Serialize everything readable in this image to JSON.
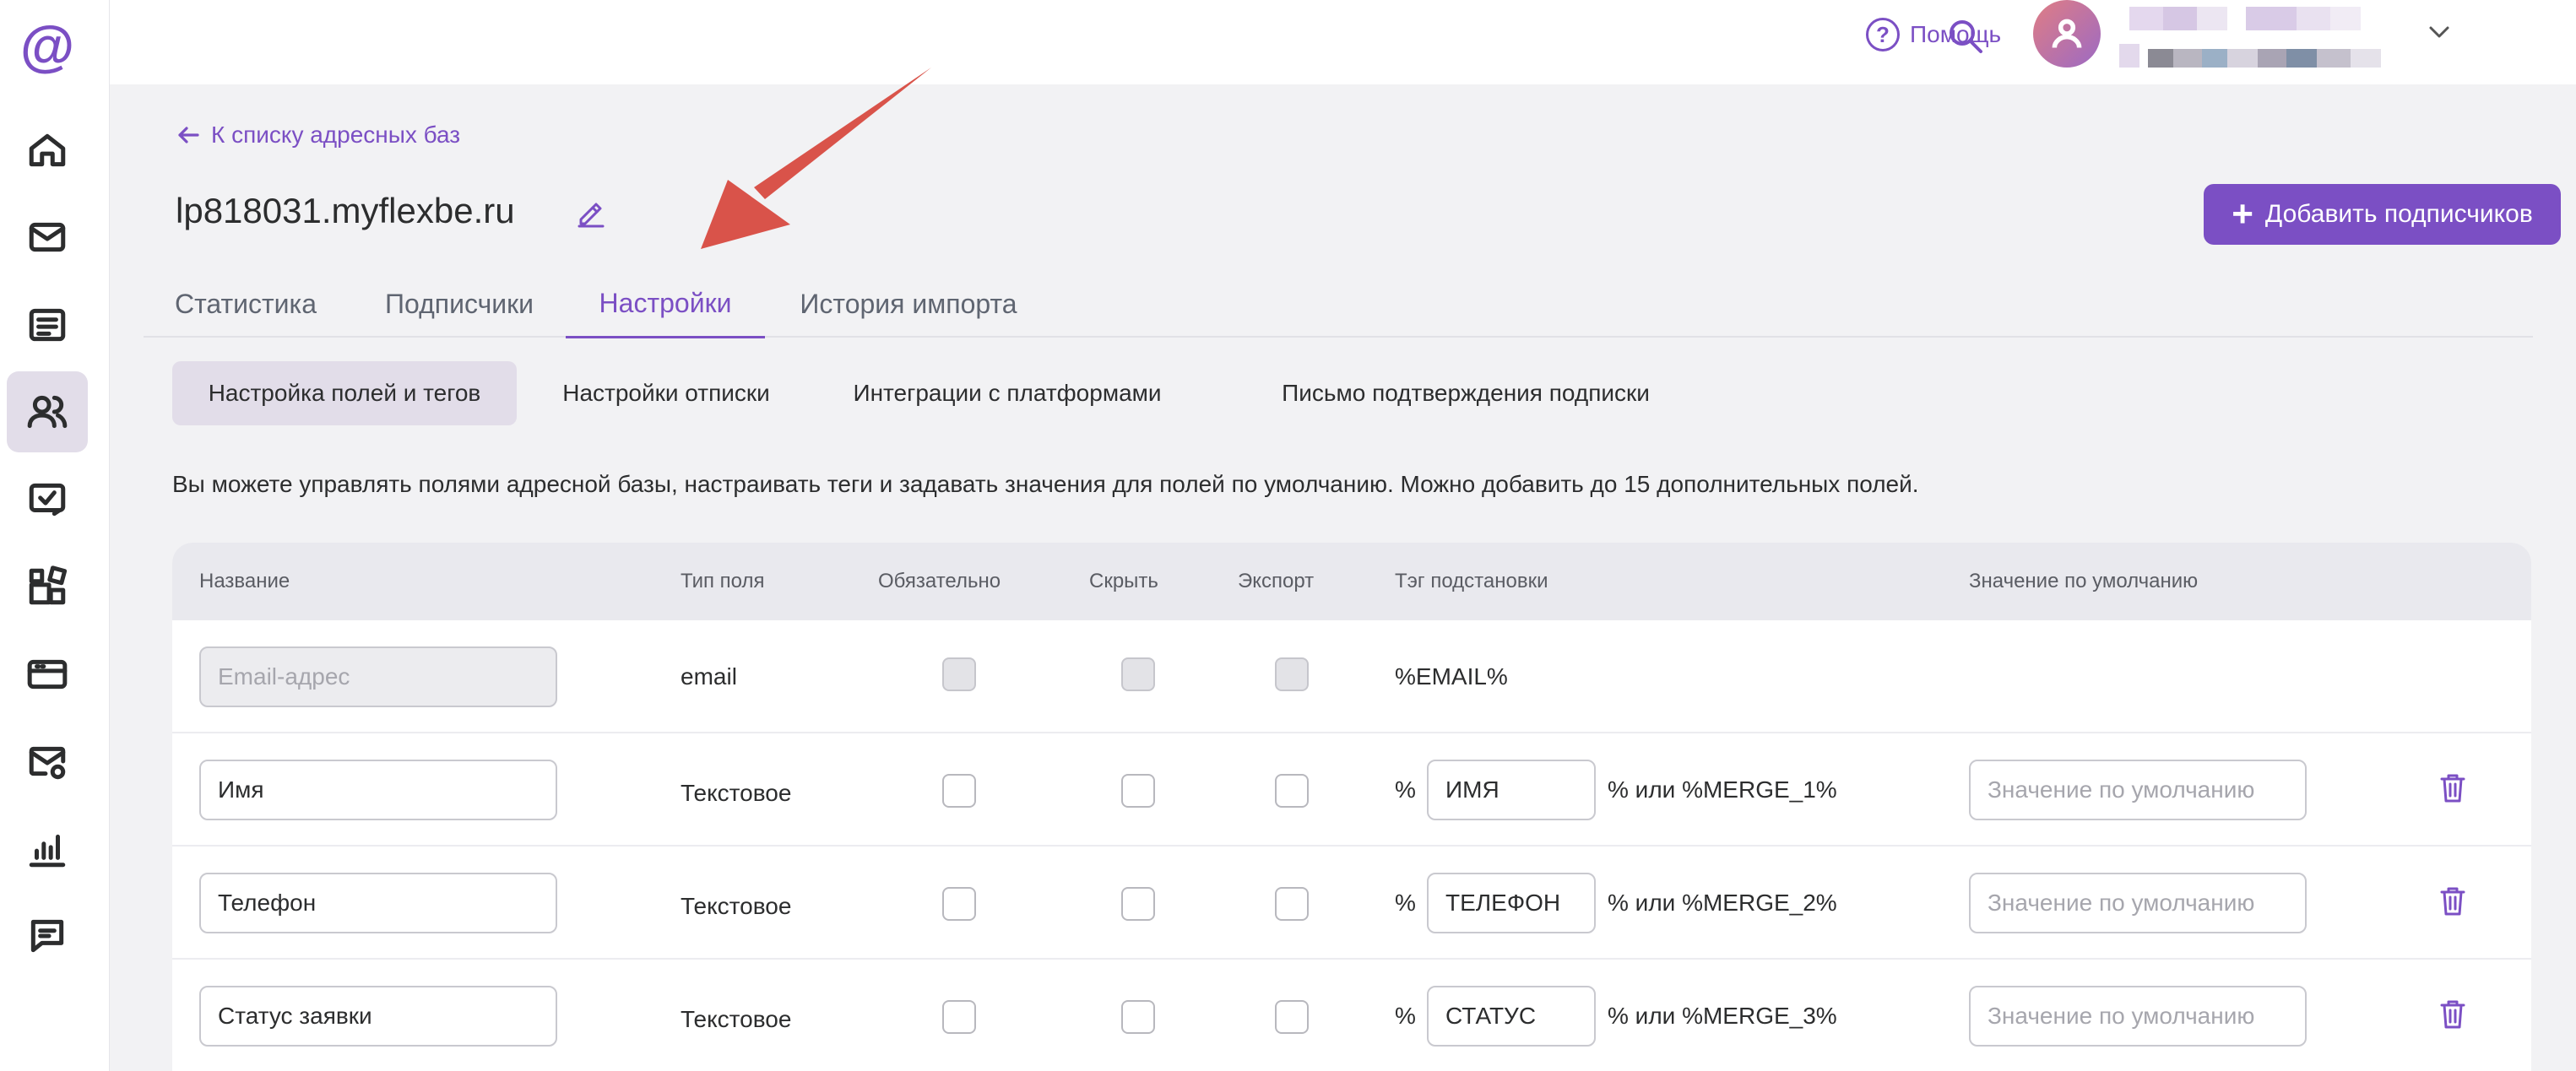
{
  "app": {
    "logo": "@"
  },
  "topbar": {
    "help_label": "Помощь",
    "help_glyph": "?"
  },
  "back_link": {
    "label": "К списку адресных баз"
  },
  "page": {
    "title": "lp818031.myflexbe.ru",
    "add_button": "Добавить подписчиков",
    "add_glyph": "+"
  },
  "tabs": [
    {
      "label": "Статистика"
    },
    {
      "label": "Подписчики"
    },
    {
      "label": "Настройки"
    },
    {
      "label": "История импорта"
    }
  ],
  "subtabs": [
    {
      "label": "Настройка полей и тегов"
    },
    {
      "label": "Настройки отписки"
    },
    {
      "label": "Интеграции с платформами"
    },
    {
      "label": "Письмо подтверждения подписки"
    }
  ],
  "description": "Вы можете управлять полями адресной базы, настраивать теги и задавать значения для полей по умолчанию. Можно добавить до 15 дополнительных полей.",
  "table": {
    "headers": {
      "name": "Название",
      "type": "Тип поля",
      "required": "Обязательно",
      "hide": "Скрыть",
      "export": "Экспорт",
      "tag": "Тэг подстановки",
      "default": "Значение по умолчанию"
    },
    "rows": [
      {
        "name_placeholder": "Email-адрес",
        "type": "email",
        "tag_text": "%EMAIL%"
      },
      {
        "name": "Имя",
        "type": "Текстовое",
        "tag_prefix": "%",
        "tag_value": "ИМЯ",
        "tag_suffix": "% или %MERGE_1%",
        "default_placeholder": "Значение по умолчанию"
      },
      {
        "name": "Телефон",
        "type": "Текстовое",
        "tag_prefix": "%",
        "tag_value": "ТЕЛЕФОН",
        "tag_suffix": "% или %MERGE_2%",
        "default_placeholder": "Значение по умолчанию"
      },
      {
        "name": "Статус заявки",
        "type": "Текстовое",
        "tag_prefix": "%",
        "tag_value": "СТАТУС",
        "tag_suffix": "% или %MERGE_3%",
        "default_placeholder": "Значение по умолчанию"
      }
    ]
  },
  "colors": {
    "accent": "#7b4fc4",
    "arrow": "#d9534a",
    "active_bg": "#e2dde9"
  },
  "icons": [
    "home-icon",
    "mail-icon",
    "list-icon",
    "users-icon",
    "task-icon",
    "blocks-icon",
    "card-icon",
    "settings-mail-icon",
    "chart-icon",
    "chat-icon",
    "search-icon",
    "question-icon",
    "user-icon",
    "chevron-down-icon",
    "arrow-left-icon",
    "pencil-icon",
    "plus-icon",
    "trash-icon"
  ]
}
